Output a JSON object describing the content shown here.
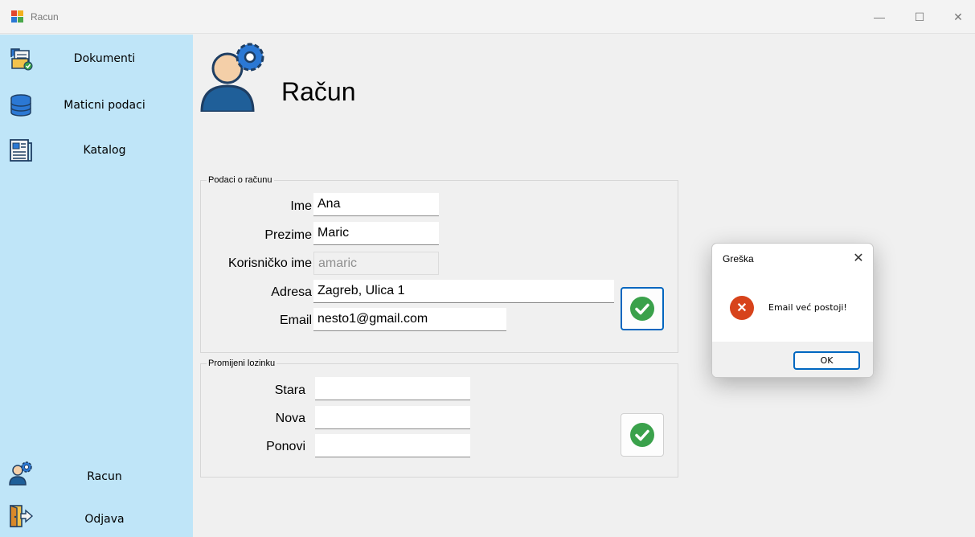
{
  "window": {
    "title": "Racun",
    "minimize": "—",
    "maximize": "☐",
    "close": "✕"
  },
  "sidebar": {
    "items": [
      {
        "label": "Dokumenti",
        "icon": "documents-icon"
      },
      {
        "label": "Maticni podaci",
        "icon": "database-icon"
      },
      {
        "label": "Katalog",
        "icon": "catalog-icon"
      }
    ],
    "bottom_items": [
      {
        "label": "Racun",
        "icon": "account-settings-icon"
      },
      {
        "label": "Odjava",
        "icon": "logout-door-icon"
      }
    ],
    "background": "#bfe5f8"
  },
  "page": {
    "title": "Račun",
    "icon": "account-settings-icon"
  },
  "account_group": {
    "legend": "Podaci o računu",
    "fields": {
      "ime": {
        "label": "Ime",
        "value": "Ana"
      },
      "prezime": {
        "label": "Prezime",
        "value": "Maric"
      },
      "korisnicko_ime": {
        "label": "Korisničko ime",
        "value": "amaric",
        "disabled": true
      },
      "adresa": {
        "label": "Adresa",
        "value": "Zagreb, Ulica 1"
      },
      "email": {
        "label": "Email",
        "value": "nesto1@gmail.com"
      }
    },
    "save_icon": "check-circle-icon"
  },
  "password_group": {
    "legend": "Promijeni lozinku",
    "fields": {
      "stara": {
        "label": "Stara",
        "value": ""
      },
      "nova": {
        "label": "Nova",
        "value": ""
      },
      "ponovi": {
        "label": "Ponovi",
        "value": ""
      }
    },
    "save_icon": "check-circle-icon"
  },
  "dialog": {
    "title": "Greška",
    "message": "Email već postoji!",
    "ok_label": "OK",
    "close": "✕",
    "icon": "error-icon",
    "error_color": "#d7431b"
  },
  "colors": {
    "accent": "#0067c0",
    "success": "#3aa14b"
  }
}
